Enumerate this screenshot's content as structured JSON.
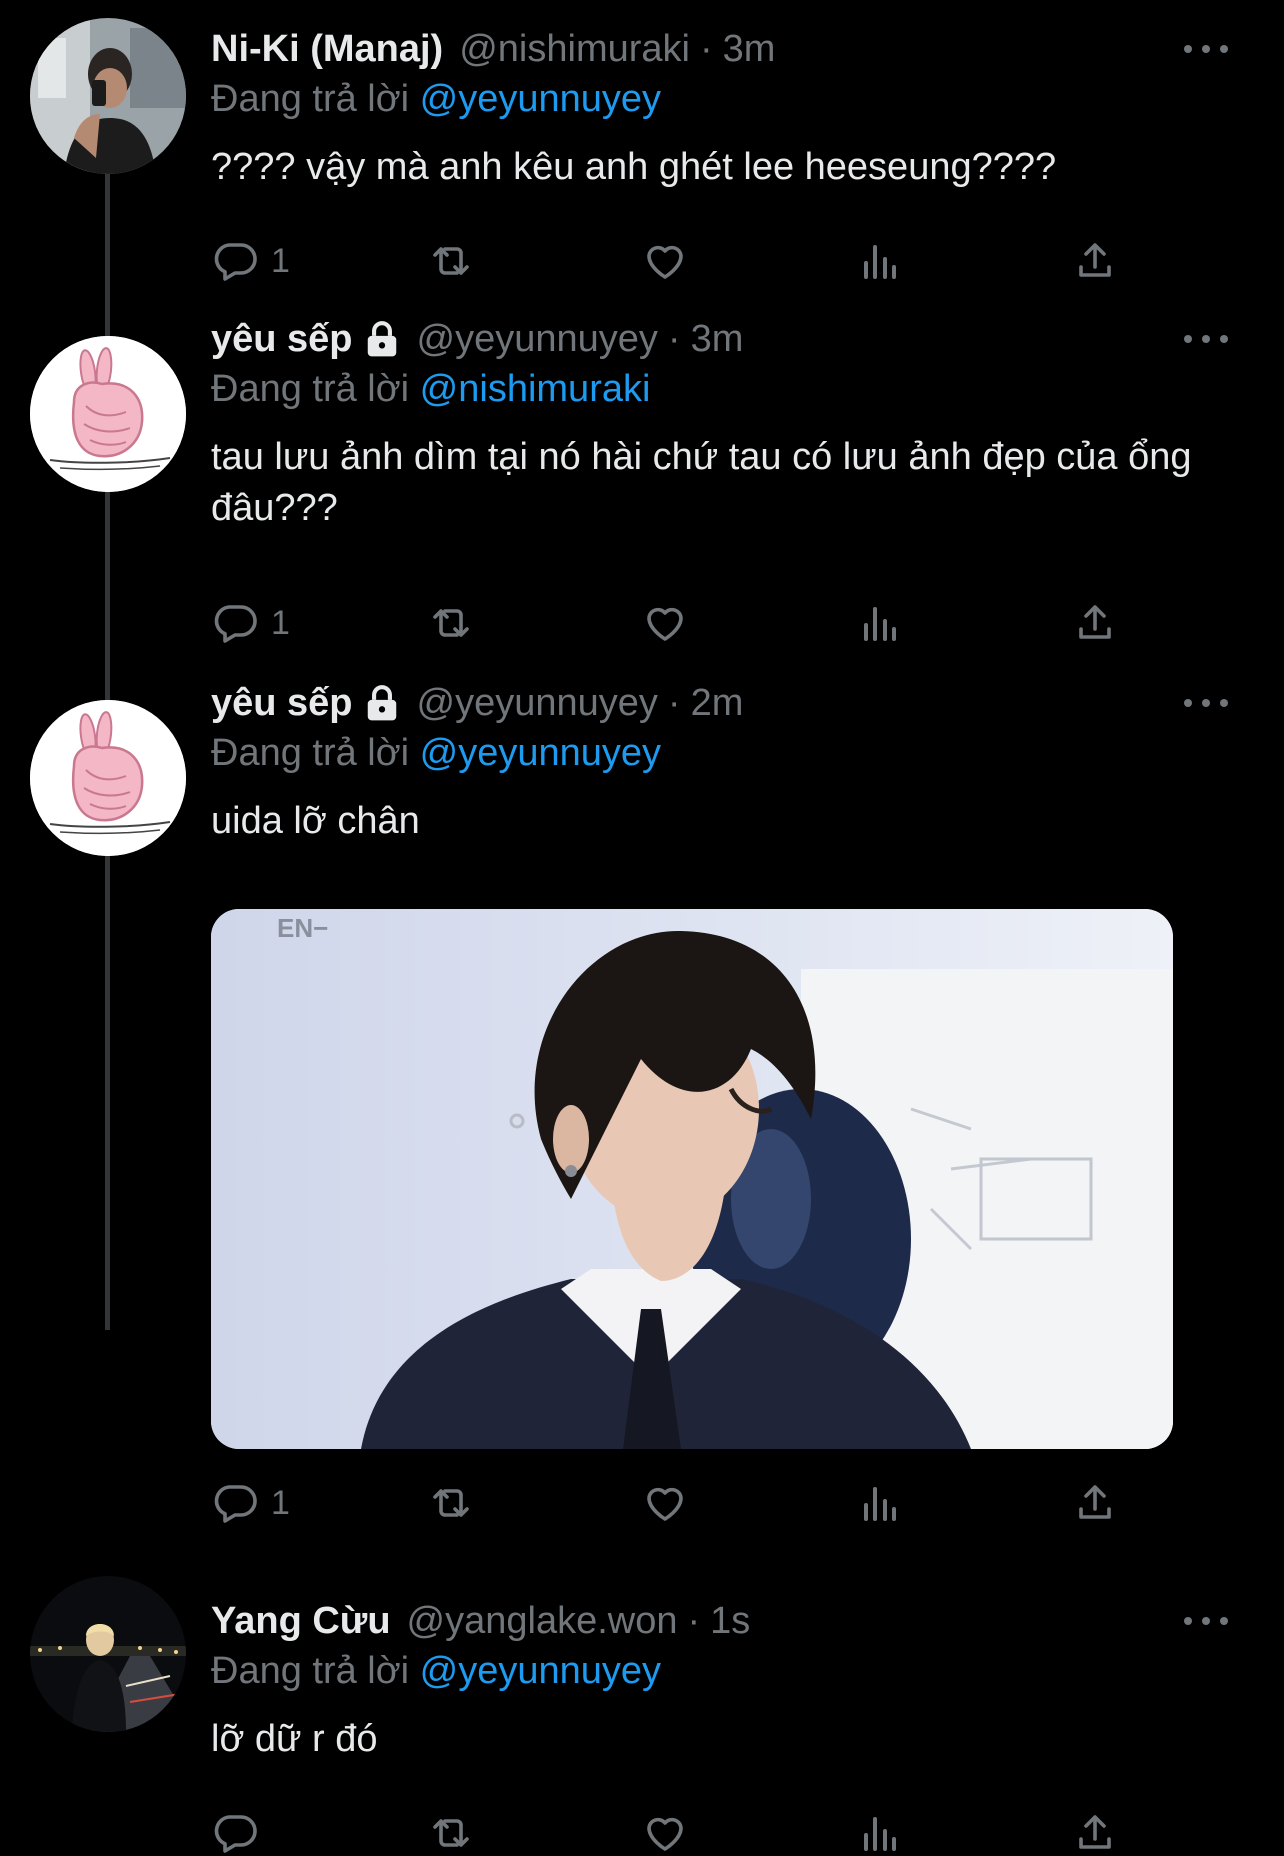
{
  "reply_prefix": "Đang trả lời",
  "tweets": [
    {
      "display_name": "Ni-Ki (Manaj)",
      "handle": "@nishimuraki",
      "time": "3m",
      "reply_to": "@yeyunnuyey",
      "text": "???? vậy mà anh kêu anh ghét lee heeseung????",
      "reply_count": "1",
      "avatar": "selfie-mirror-avatar"
    },
    {
      "display_name": "yêu sếp",
      "handle": "@yeyunnuyey",
      "time": "3m",
      "reply_to": "@nishimuraki",
      "text": "tau lưu ảnh dìm tại nó hài chứ tau có lưu ảnh đẹp của ổng đâu???",
      "reply_count": "1",
      "avatar": "pink-rabbit-avatar"
    },
    {
      "display_name": "yêu sếp",
      "handle": "@yeyunnuyey",
      "time": "2m",
      "reply_to": "@yeyunnuyey",
      "text": "uida lỡ chân",
      "reply_count": "1",
      "avatar": "pink-rabbit-avatar",
      "media_watermark": "EN−"
    },
    {
      "display_name": "Yang Cừu",
      "handle": "@yanglake.won",
      "time": "1s",
      "reply_to": "@yeyunnuyey",
      "text": "lỡ dữ r đó",
      "reply_count": "",
      "avatar": "night-city-avatar"
    }
  ],
  "colors": {
    "background": "#000000",
    "text": "#e7e9ea",
    "muted": "#71767b",
    "link": "#1d9bf0",
    "thread_line": "#333639"
  },
  "icons": [
    "reply-icon",
    "retweet-icon",
    "like-icon",
    "views-icon",
    "share-icon",
    "more-icon",
    "lock-icon"
  ]
}
